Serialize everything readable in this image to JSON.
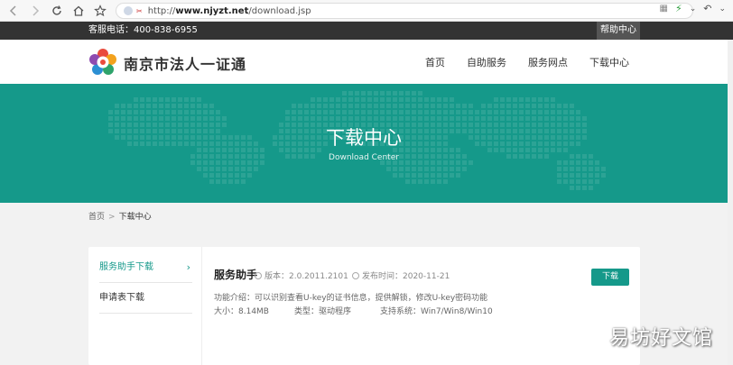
{
  "browser": {
    "url_scheme": "http://",
    "url_host": "www.njyzt.net",
    "url_path": "/download.jsp"
  },
  "topbar": {
    "hotline": "客服电话：400-838-6955",
    "help": "帮助中心"
  },
  "header": {
    "site_name": "南京市法人一证通",
    "nav": [
      "首页",
      "自助服务",
      "服务网点",
      "下载中心"
    ]
  },
  "banner": {
    "title": "下载中心",
    "subtitle": "Download Center"
  },
  "breadcrumb": {
    "home": "首页",
    "separator": ">",
    "current": "下载中心"
  },
  "sidebar": {
    "items": [
      {
        "label": "服务助手下载",
        "arrow": "›"
      },
      {
        "label": "申请表下载"
      }
    ]
  },
  "item": {
    "title": "服务助手",
    "version": "版本：2.0.2011.2101",
    "date": "发布时间：2020-11-21",
    "description": "功能介绍：可以识别查看U-key的证书信息，提供解锁，修改U-key密码功能",
    "size": "大小：8.14MB",
    "type": "类型：驱动程序",
    "system": "支持系统：Win7/Win8/Win10",
    "download_label": "下载"
  },
  "watermark": "易坊好文馆",
  "colors": {
    "accent": "#15998a",
    "topbar": "#333333"
  }
}
